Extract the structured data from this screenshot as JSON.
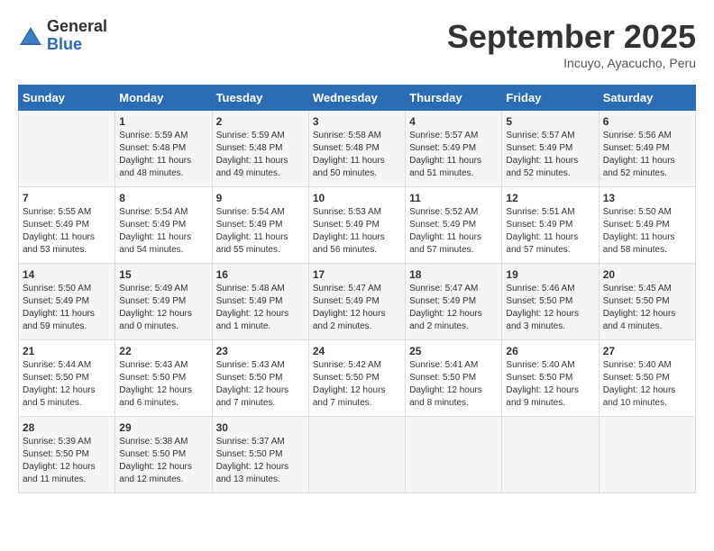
{
  "header": {
    "logo_general": "General",
    "logo_blue": "Blue",
    "month_title": "September 2025",
    "subtitle": "Incuyo, Ayacucho, Peru"
  },
  "days_of_week": [
    "Sunday",
    "Monday",
    "Tuesday",
    "Wednesday",
    "Thursday",
    "Friday",
    "Saturday"
  ],
  "weeks": [
    [
      {
        "day": "",
        "info": ""
      },
      {
        "day": "1",
        "info": "Sunrise: 5:59 AM\nSunset: 5:48 PM\nDaylight: 11 hours\nand 48 minutes."
      },
      {
        "day": "2",
        "info": "Sunrise: 5:59 AM\nSunset: 5:48 PM\nDaylight: 11 hours\nand 49 minutes."
      },
      {
        "day": "3",
        "info": "Sunrise: 5:58 AM\nSunset: 5:48 PM\nDaylight: 11 hours\nand 50 minutes."
      },
      {
        "day": "4",
        "info": "Sunrise: 5:57 AM\nSunset: 5:49 PM\nDaylight: 11 hours\nand 51 minutes."
      },
      {
        "day": "5",
        "info": "Sunrise: 5:57 AM\nSunset: 5:49 PM\nDaylight: 11 hours\nand 52 minutes."
      },
      {
        "day": "6",
        "info": "Sunrise: 5:56 AM\nSunset: 5:49 PM\nDaylight: 11 hours\nand 52 minutes."
      }
    ],
    [
      {
        "day": "7",
        "info": "Sunrise: 5:55 AM\nSunset: 5:49 PM\nDaylight: 11 hours\nand 53 minutes."
      },
      {
        "day": "8",
        "info": "Sunrise: 5:54 AM\nSunset: 5:49 PM\nDaylight: 11 hours\nand 54 minutes."
      },
      {
        "day": "9",
        "info": "Sunrise: 5:54 AM\nSunset: 5:49 PM\nDaylight: 11 hours\nand 55 minutes."
      },
      {
        "day": "10",
        "info": "Sunrise: 5:53 AM\nSunset: 5:49 PM\nDaylight: 11 hours\nand 56 minutes."
      },
      {
        "day": "11",
        "info": "Sunrise: 5:52 AM\nSunset: 5:49 PM\nDaylight: 11 hours\nand 57 minutes."
      },
      {
        "day": "12",
        "info": "Sunrise: 5:51 AM\nSunset: 5:49 PM\nDaylight: 11 hours\nand 57 minutes."
      },
      {
        "day": "13",
        "info": "Sunrise: 5:50 AM\nSunset: 5:49 PM\nDaylight: 11 hours\nand 58 minutes."
      }
    ],
    [
      {
        "day": "14",
        "info": "Sunrise: 5:50 AM\nSunset: 5:49 PM\nDaylight: 11 hours\nand 59 minutes."
      },
      {
        "day": "15",
        "info": "Sunrise: 5:49 AM\nSunset: 5:49 PM\nDaylight: 12 hours\nand 0 minutes."
      },
      {
        "day": "16",
        "info": "Sunrise: 5:48 AM\nSunset: 5:49 PM\nDaylight: 12 hours\nand 1 minute."
      },
      {
        "day": "17",
        "info": "Sunrise: 5:47 AM\nSunset: 5:49 PM\nDaylight: 12 hours\nand 2 minutes."
      },
      {
        "day": "18",
        "info": "Sunrise: 5:47 AM\nSunset: 5:49 PM\nDaylight: 12 hours\nand 2 minutes."
      },
      {
        "day": "19",
        "info": "Sunrise: 5:46 AM\nSunset: 5:50 PM\nDaylight: 12 hours\nand 3 minutes."
      },
      {
        "day": "20",
        "info": "Sunrise: 5:45 AM\nSunset: 5:50 PM\nDaylight: 12 hours\nand 4 minutes."
      }
    ],
    [
      {
        "day": "21",
        "info": "Sunrise: 5:44 AM\nSunset: 5:50 PM\nDaylight: 12 hours\nand 5 minutes."
      },
      {
        "day": "22",
        "info": "Sunrise: 5:43 AM\nSunset: 5:50 PM\nDaylight: 12 hours\nand 6 minutes."
      },
      {
        "day": "23",
        "info": "Sunrise: 5:43 AM\nSunset: 5:50 PM\nDaylight: 12 hours\nand 7 minutes."
      },
      {
        "day": "24",
        "info": "Sunrise: 5:42 AM\nSunset: 5:50 PM\nDaylight: 12 hours\nand 7 minutes."
      },
      {
        "day": "25",
        "info": "Sunrise: 5:41 AM\nSunset: 5:50 PM\nDaylight: 12 hours\nand 8 minutes."
      },
      {
        "day": "26",
        "info": "Sunrise: 5:40 AM\nSunset: 5:50 PM\nDaylight: 12 hours\nand 9 minutes."
      },
      {
        "day": "27",
        "info": "Sunrise: 5:40 AM\nSunset: 5:50 PM\nDaylight: 12 hours\nand 10 minutes."
      }
    ],
    [
      {
        "day": "28",
        "info": "Sunrise: 5:39 AM\nSunset: 5:50 PM\nDaylight: 12 hours\nand 11 minutes."
      },
      {
        "day": "29",
        "info": "Sunrise: 5:38 AM\nSunset: 5:50 PM\nDaylight: 12 hours\nand 12 minutes."
      },
      {
        "day": "30",
        "info": "Sunrise: 5:37 AM\nSunset: 5:50 PM\nDaylight: 12 hours\nand 13 minutes."
      },
      {
        "day": "",
        "info": ""
      },
      {
        "day": "",
        "info": ""
      },
      {
        "day": "",
        "info": ""
      },
      {
        "day": "",
        "info": ""
      }
    ]
  ]
}
